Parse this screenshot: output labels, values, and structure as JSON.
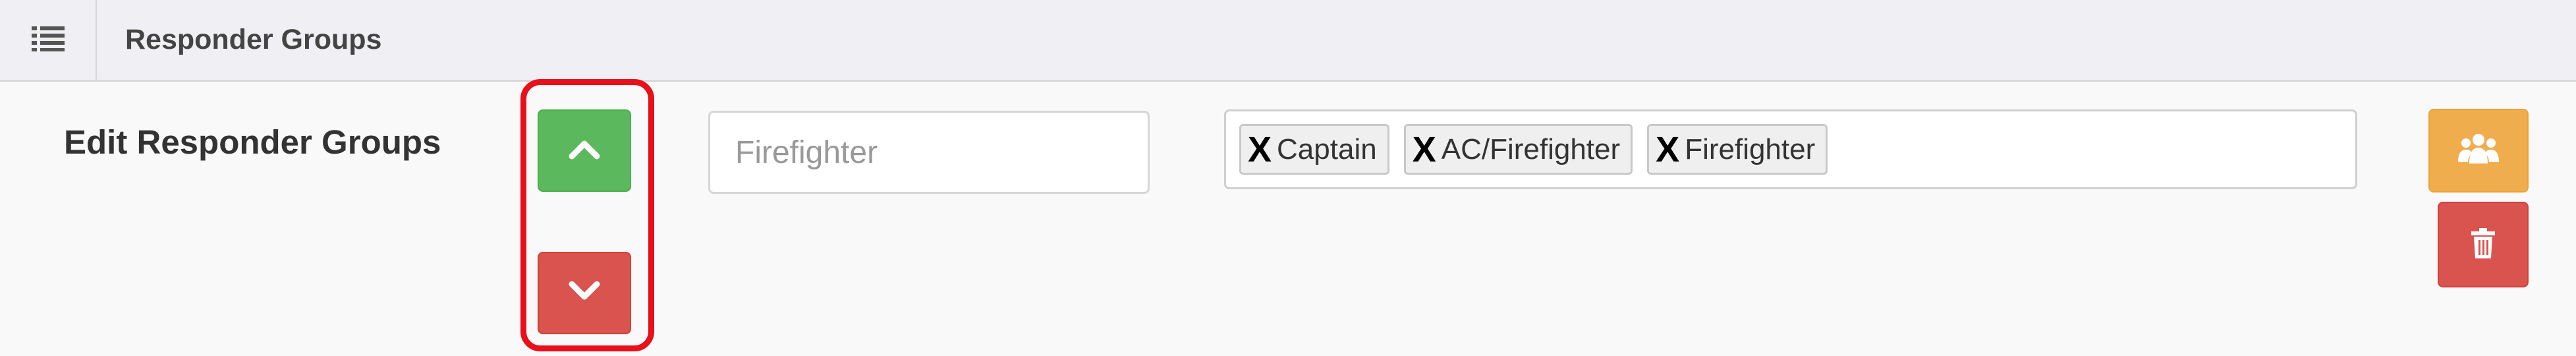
{
  "header": {
    "title": "Responder Groups",
    "menu_icon": "list-icon"
  },
  "section": {
    "label": "Edit Responder Groups"
  },
  "controls": {
    "move_up_icon": "chevron-up-icon",
    "move_down_icon": "chevron-down-icon",
    "group_icon": "users-icon",
    "delete_icon": "trash-icon"
  },
  "group_name": {
    "value": "",
    "placeholder": "Firefighter"
  },
  "tags": [
    {
      "remove": "X",
      "label": "Captain"
    },
    {
      "remove": "X",
      "label": "AC/Firefighter"
    },
    {
      "remove": "X",
      "label": "Firefighter"
    }
  ],
  "colors": {
    "success": "#5cb85c",
    "danger": "#d9534f",
    "warning": "#f0ad4e",
    "highlight": "#e8101b"
  }
}
